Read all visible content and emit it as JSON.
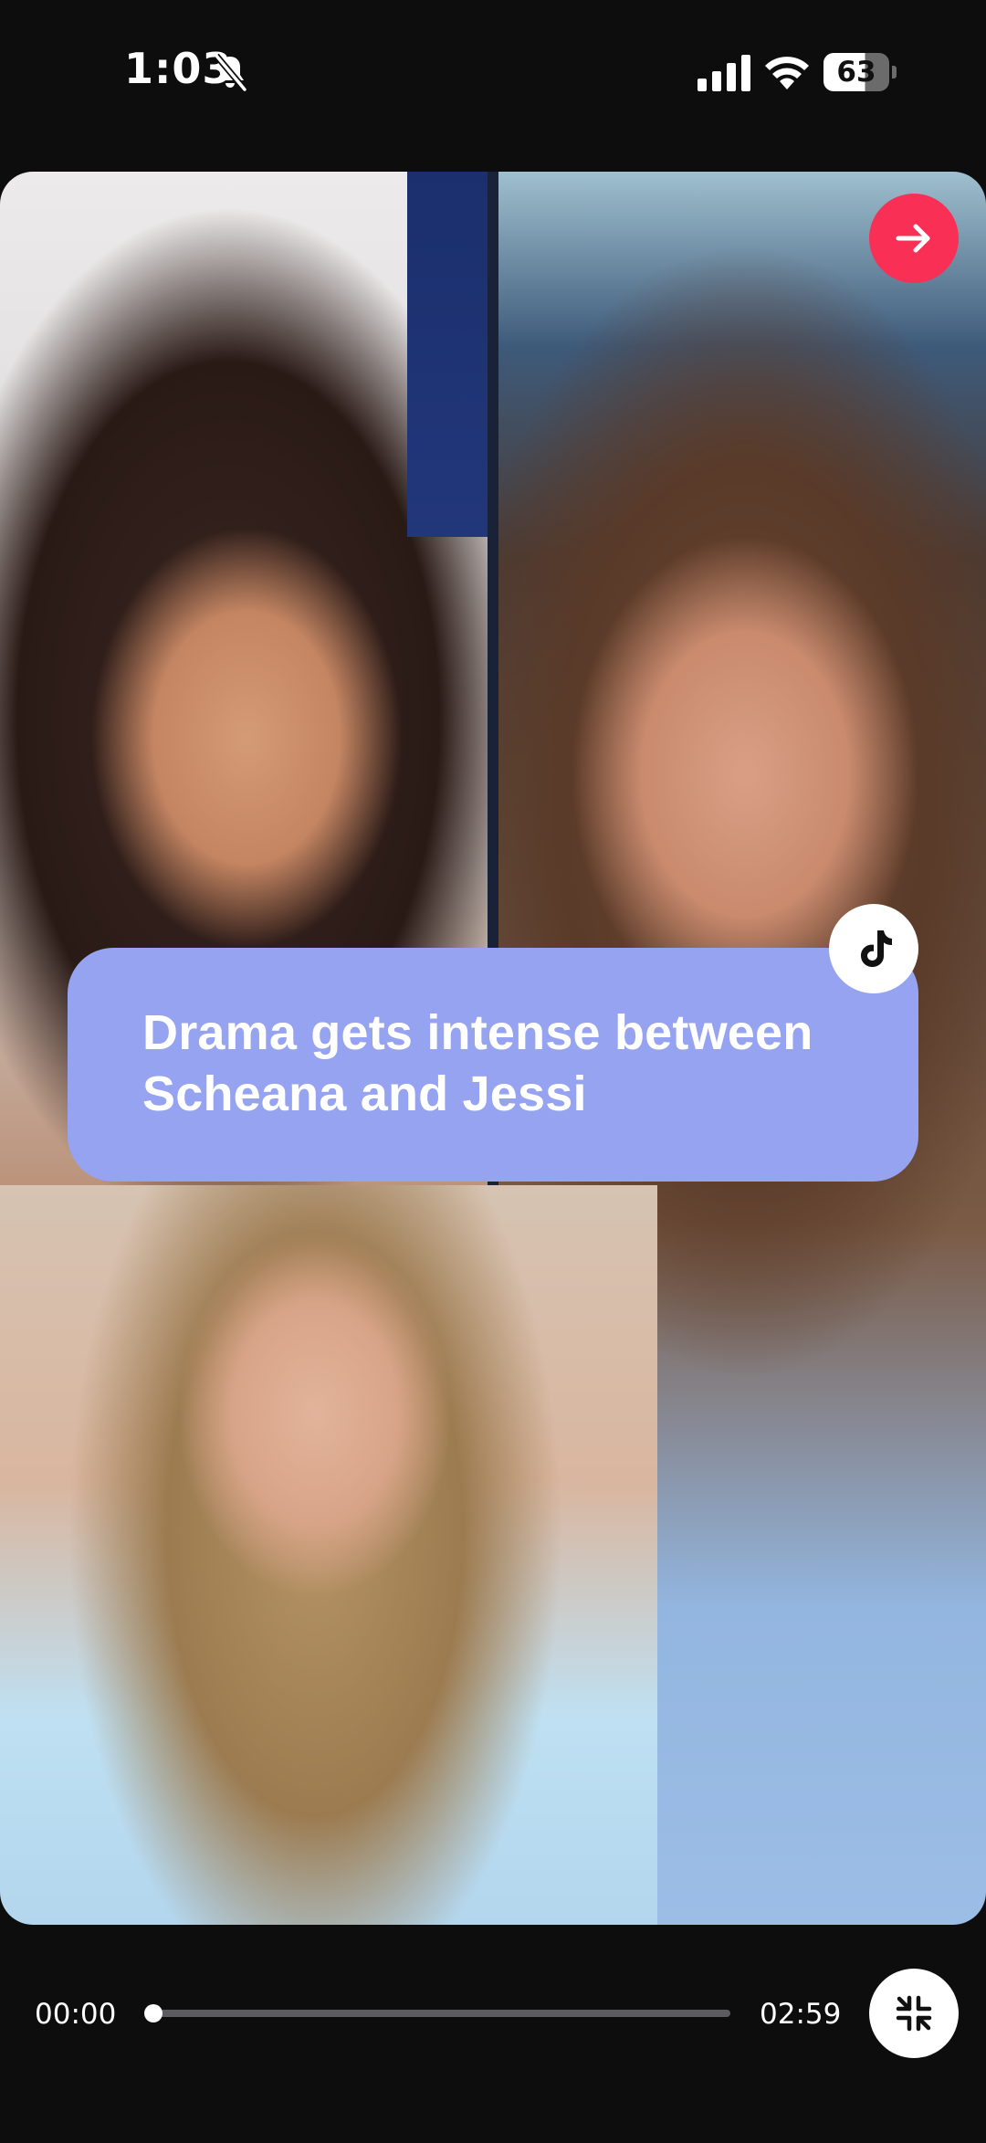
{
  "status_bar": {
    "time": "1:03",
    "battery_level": "63",
    "battery_fraction": 0.63,
    "icons": [
      "bell-off-icon",
      "cellular-signal-icon",
      "wifi-icon",
      "battery-icon"
    ]
  },
  "story": {
    "caption": "Drama gets intense between Scheana and Jessi",
    "source_icon": "tiktok-logo-icon",
    "skip_icon": "arrow-right-icon",
    "colors": {
      "caption_background": "#95a3f0",
      "skip_button": "#fa2f55"
    }
  },
  "player": {
    "current_time": "00:00",
    "total_time": "02:59",
    "progress_fraction": 0.0,
    "minimize_icon": "collapse-arrows-icon"
  }
}
